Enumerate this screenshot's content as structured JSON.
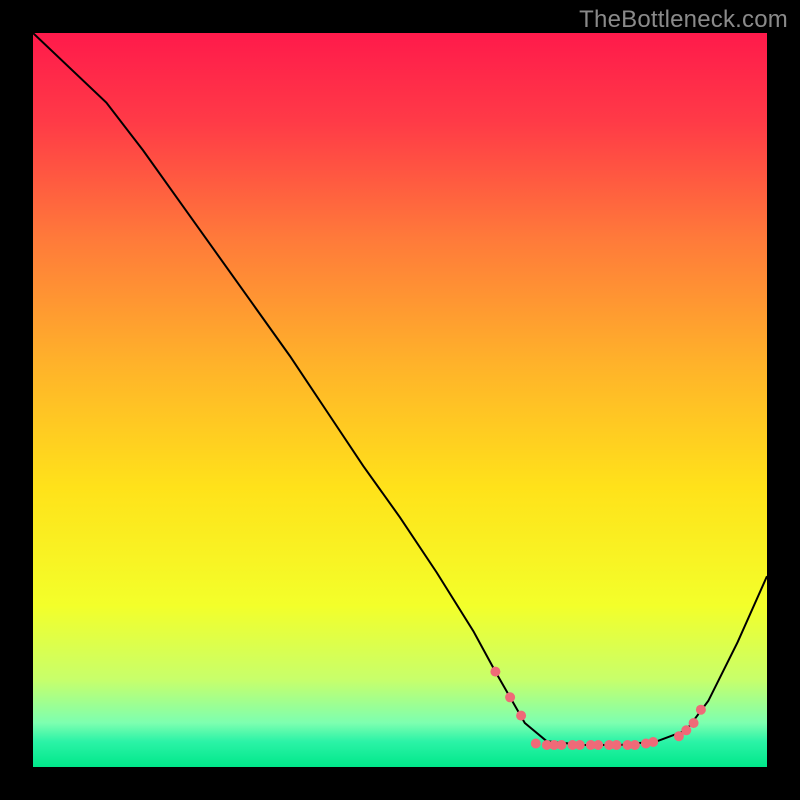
{
  "watermark": "TheBottleneck.com",
  "chart_data": {
    "type": "line",
    "title": "",
    "xlabel": "",
    "ylabel": "",
    "xlim": [
      0,
      100
    ],
    "ylim": [
      0,
      100
    ],
    "grid": false,
    "legend": false,
    "background": {
      "type": "vertical-gradient",
      "stops": [
        {
          "pos": 0.0,
          "color": "#ff1a4b"
        },
        {
          "pos": 0.12,
          "color": "#ff3a47"
        },
        {
          "pos": 0.28,
          "color": "#ff7a3a"
        },
        {
          "pos": 0.45,
          "color": "#ffb22a"
        },
        {
          "pos": 0.62,
          "color": "#ffe21a"
        },
        {
          "pos": 0.78,
          "color": "#f3ff2a"
        },
        {
          "pos": 0.88,
          "color": "#c8ff6a"
        },
        {
          "pos": 0.94,
          "color": "#7dffb0"
        },
        {
          "pos": 0.965,
          "color": "#2cf3a7"
        },
        {
          "pos": 1.0,
          "color": "#00e88a"
        }
      ]
    },
    "series": [
      {
        "name": "curve",
        "color": "#000000",
        "width": 2,
        "x": [
          0.0,
          10.0,
          15.0,
          20.0,
          25.0,
          30.0,
          35.0,
          40.0,
          45.0,
          50.0,
          55.0,
          60.0,
          63.0,
          65.0,
          67.0,
          70.0,
          75.0,
          80.0,
          85.0,
          89.0,
          92.0,
          96.0,
          100.0
        ],
        "y": [
          100.0,
          90.5,
          84.0,
          77.0,
          70.0,
          63.0,
          56.0,
          48.5,
          41.0,
          34.0,
          26.5,
          18.5,
          13.0,
          9.5,
          6.0,
          3.5,
          3.0,
          3.0,
          3.5,
          5.0,
          9.0,
          17.0,
          26.0
        ]
      }
    ],
    "markers": {
      "color": "#ef6a78",
      "radius": 5,
      "points": [
        {
          "x": 63.0,
          "y": 13.0
        },
        {
          "x": 65.0,
          "y": 9.5
        },
        {
          "x": 66.5,
          "y": 7.0
        },
        {
          "x": 68.5,
          "y": 3.2
        },
        {
          "x": 70.0,
          "y": 3.0
        },
        {
          "x": 71.0,
          "y": 3.0
        },
        {
          "x": 72.0,
          "y": 3.0
        },
        {
          "x": 73.5,
          "y": 3.0
        },
        {
          "x": 74.5,
          "y": 3.0
        },
        {
          "x": 76.0,
          "y": 3.0
        },
        {
          "x": 77.0,
          "y": 3.0
        },
        {
          "x": 78.5,
          "y": 3.0
        },
        {
          "x": 79.5,
          "y": 3.0
        },
        {
          "x": 81.0,
          "y": 3.0
        },
        {
          "x": 82.0,
          "y": 3.0
        },
        {
          "x": 83.5,
          "y": 3.2
        },
        {
          "x": 84.5,
          "y": 3.4
        },
        {
          "x": 88.0,
          "y": 4.2
        },
        {
          "x": 89.0,
          "y": 5.0
        },
        {
          "x": 90.0,
          "y": 6.0
        },
        {
          "x": 91.0,
          "y": 7.8
        }
      ]
    }
  }
}
